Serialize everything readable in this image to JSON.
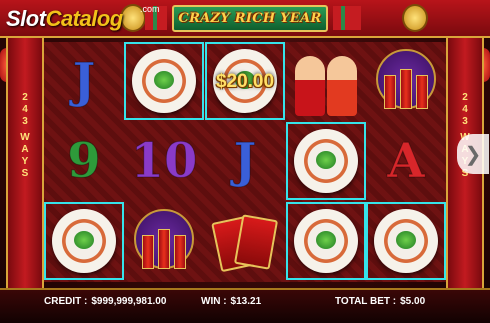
{
  "brand": {
    "logo_plain": "Slot",
    "logo_bold": "Catalog",
    "logo_suffix": ".com"
  },
  "game": {
    "title": "CRAZY RICH YEAR",
    "ways_left": [
      "2",
      "4",
      "3",
      "W",
      "A",
      "Y",
      "S"
    ],
    "ways_right": [
      "2",
      "4",
      "3",
      "W",
      "A",
      "Y",
      "S"
    ]
  },
  "reels": [
    [
      {
        "type": "card",
        "glyph": "J",
        "color": "#3a5fd8",
        "win": false
      },
      {
        "type": "card",
        "glyph": "9",
        "color": "#2e9a3a",
        "win": false
      },
      {
        "type": "dumpling",
        "win": true
      }
    ],
    [
      {
        "type": "dumpling",
        "win": true
      },
      {
        "type": "card",
        "glyph": "10",
        "color": "#8a3ac8",
        "win": false
      },
      {
        "type": "firecracker",
        "win": false
      }
    ],
    [
      {
        "type": "dumpling",
        "win": true,
        "prize": "$20.00"
      },
      {
        "type": "card",
        "glyph": "J",
        "color": "#3a5fd8",
        "win": false
      },
      {
        "type": "envelope",
        "win": false
      }
    ],
    [
      {
        "type": "kids",
        "win": false
      },
      {
        "type": "dumpling",
        "win": true
      },
      {
        "type": "dumpling",
        "win": true
      }
    ],
    [
      {
        "type": "firecracker",
        "win": false
      },
      {
        "type": "card",
        "glyph": "A",
        "color": "#d8262a",
        "win": false
      },
      {
        "type": "dumpling",
        "win": true
      }
    ]
  ],
  "footer": {
    "credit_label": "CREDIT :",
    "credit_value": "$999,999,981.00",
    "win_label": "WIN :",
    "win_value": "$13.21",
    "bet_label": "TOTAL BET :",
    "bet_value": "$5.00"
  },
  "colors": {
    "accent": "#35e3ea",
    "gold": "#ffe066",
    "banner": "#b8141a"
  },
  "icons": {
    "next": "chevron-right-icon"
  }
}
